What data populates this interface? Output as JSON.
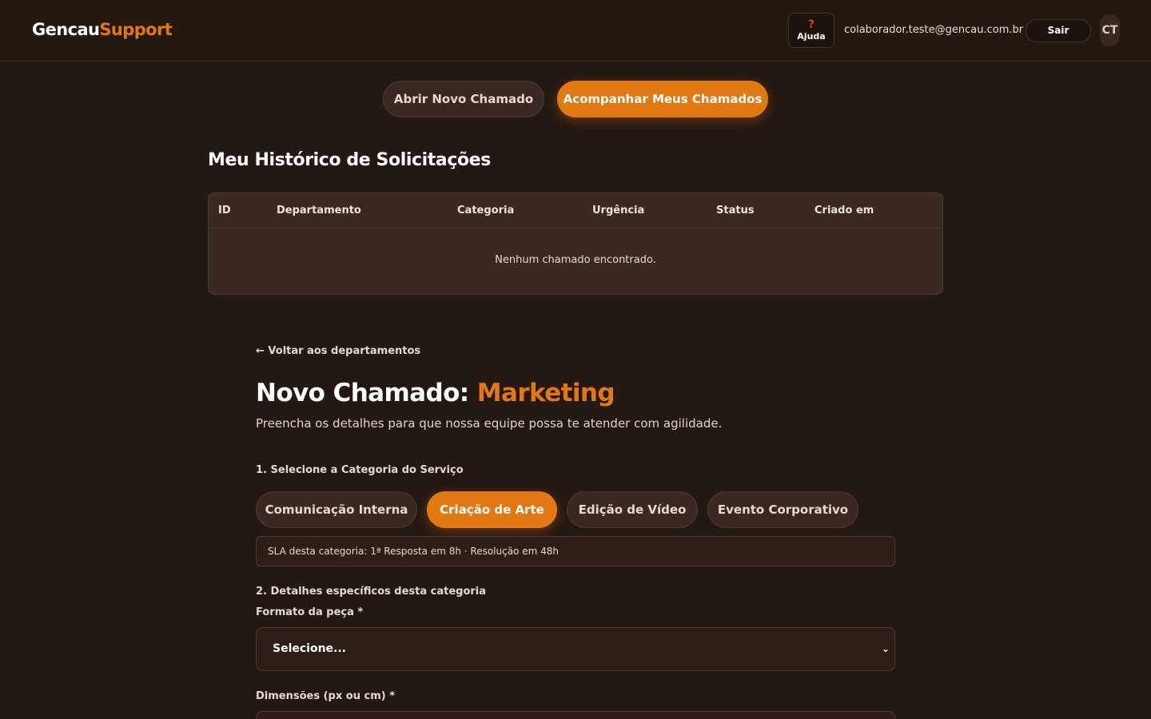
{
  "header": {
    "logo_part1": "Gencau",
    "logo_part2": "Support",
    "help_icon": "?",
    "help_label": "Ajuda",
    "user_email": "colaborador.teste@gencau.com.br",
    "logout_label": "Sair",
    "avatar_initials": "CT"
  },
  "tabs": {
    "open_label": "Abrir Novo Chamado",
    "track_label": "Acompanhar Meus Chamados",
    "active": "track"
  },
  "history": {
    "title": "Meu Histórico de Solicitações",
    "columns": [
      "ID",
      "Departamento",
      "Categoria",
      "Urgência",
      "Status",
      "Criado em"
    ],
    "empty_message": "Nenhum chamado encontrado."
  },
  "form": {
    "back_link": "← Voltar aos departamentos",
    "title_prefix": "Novo Chamado: ",
    "department": "Marketing",
    "subtitle": "Preencha os detalhes para que nossa equipe possa te atender com agilidade.",
    "step1_label": "1. Selecione a Categoria do Serviço",
    "categories": [
      {
        "label": "Comunicação Interna",
        "active": false
      },
      {
        "label": "Criação de Arte",
        "active": true
      },
      {
        "label": "Edição de Vídeo",
        "active": false
      },
      {
        "label": "Evento Corporativo",
        "active": false
      }
    ],
    "sla_text": "SLA desta categoria: 1ª Resposta em 8h · Resolução em 48h",
    "step2_label": "2. Detalhes específicos desta categoria",
    "format_label": "Formato da peça *",
    "format_value": "Selecione...",
    "dimensions_label": "Dimensões (px ou cm) *",
    "dimensions_value": ""
  },
  "colors": {
    "accent": "#e27812",
    "background": "#241812",
    "panel": "#3b2820"
  }
}
